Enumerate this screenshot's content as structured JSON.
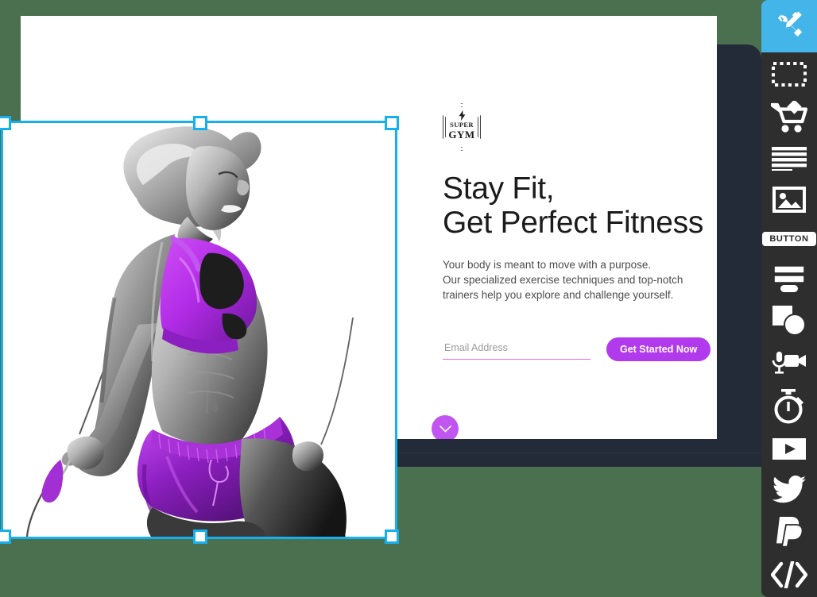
{
  "app": {
    "background_color": "#4a7050",
    "window_frame_color": "#232b38",
    "accent_purple": "#b03aec",
    "accent_pink": "#e36ae0",
    "selection_color": "#17b0ef",
    "toolbar_bg": "#2e2e2e",
    "toolbar_active_bg": "#44b5e8"
  },
  "hero": {
    "logo": {
      "bolt": "⚡",
      "line1": "SUPER",
      "line2": "GYM",
      "name": "super-gym-badge"
    },
    "headline": "Stay Fit,\nGet Perfect Fitness",
    "subcopy": "Your body is meant to move with a purpose.\nOur specialized exercise techniques and top-notch\ntrainers help you explore and challenge yourself.",
    "form": {
      "email_placeholder": "Email Address",
      "email_value": "",
      "cta_label": "Get Started Now"
    },
    "scroll_down": {
      "icon": "chevron-down-icon",
      "color": "#c155ef"
    },
    "photo": {
      "alt": "Fitness woman with jump rope, duotone purple and grayscale",
      "selected": true,
      "handle_count": 6
    }
  },
  "toolbar": {
    "items": [
      {
        "id": "tools",
        "icon": "wrench-pen-tools-icon",
        "label": "Tools",
        "active": true
      },
      {
        "id": "section",
        "icon": "dashed-rectangle-icon",
        "label": "Section",
        "active": false
      },
      {
        "id": "store",
        "icon": "shopping-cart-icon",
        "label": "Store",
        "active": false
      },
      {
        "id": "text",
        "icon": "text-lines-icon",
        "label": "Text",
        "active": false
      },
      {
        "id": "image",
        "icon": "image-icon",
        "label": "Image",
        "active": false
      },
      {
        "id": "button",
        "icon": "button-chip-icon",
        "label": "BUTTON",
        "active": false
      },
      {
        "id": "form",
        "icon": "form-fields-icon",
        "label": "Form",
        "active": false
      },
      {
        "id": "shapes",
        "icon": "square-circle-icon",
        "label": "Shapes",
        "active": false
      },
      {
        "id": "media",
        "icon": "mic-video-camera-icon",
        "label": "Media",
        "active": false
      },
      {
        "id": "countdown",
        "icon": "stopwatch-icon",
        "label": "Countdown",
        "active": false
      },
      {
        "id": "video",
        "icon": "play-video-icon",
        "label": "Video",
        "active": false
      },
      {
        "id": "twitter",
        "icon": "twitter-bird-icon",
        "label": "Twitter",
        "active": false
      },
      {
        "id": "paypal",
        "icon": "paypal-icon",
        "label": "PayPal",
        "active": false
      },
      {
        "id": "embed",
        "icon": "code-brackets-icon",
        "label": "Embed Code",
        "active": false
      }
    ]
  }
}
